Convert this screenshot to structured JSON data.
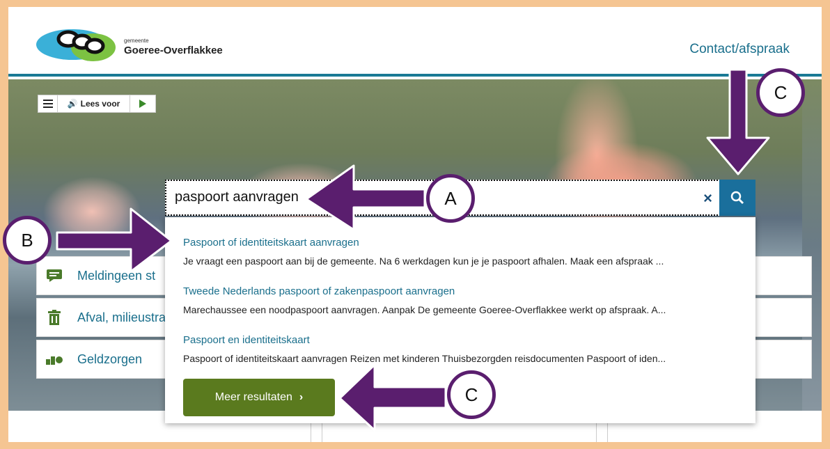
{
  "header": {
    "logo_small": "gemeente",
    "logo_name": "Goeree-Overflakkee",
    "contact_link": "Contact/afspraak"
  },
  "toolbar": {
    "read_aloud": "Lees voor"
  },
  "quick_links": [
    {
      "label": "Meldinge",
      "extra": " en st",
      "icon": "message-icon"
    },
    {
      "label": "Afval, milieustra",
      "icon": "trash-icon"
    },
    {
      "label": "Geldzorgen",
      "icon": "money-icon"
    }
  ],
  "search": {
    "value": "paspoort aanvragen",
    "clear": "×"
  },
  "results": [
    {
      "title": "Paspoort of identiteitskaart aanvragen",
      "desc": "Je vraagt een paspoort aan bij de gemeente. Na 6 werkdagen kun je je paspoort afhalen. Maak een afspraak ..."
    },
    {
      "title": "Tweede Nederlands paspoort of zakenpaspoort aanvragen",
      "desc": "Marechaussee een noodpaspoort aanvragen. Aanpak De gemeente Goeree-Overflakkee werkt op afspraak.  A..."
    },
    {
      "title": "Paspoort en identiteitskaart",
      "desc": "Paspoort of identiteitskaart aanvragen Reizen met kinderen Thuisbezorgden reisdocumenten Paspoort of iden..."
    }
  ],
  "more_button": "Meer resultaten",
  "annotations": {
    "a": "A",
    "b": "B",
    "c_top": "C",
    "c_bottom": "C",
    "color": "#5a1e6e"
  },
  "colors": {
    "frame": "#f5c592",
    "link": "#1a6f8c",
    "search_button": "#1a6f9c",
    "more_button": "#5a7a1e"
  }
}
